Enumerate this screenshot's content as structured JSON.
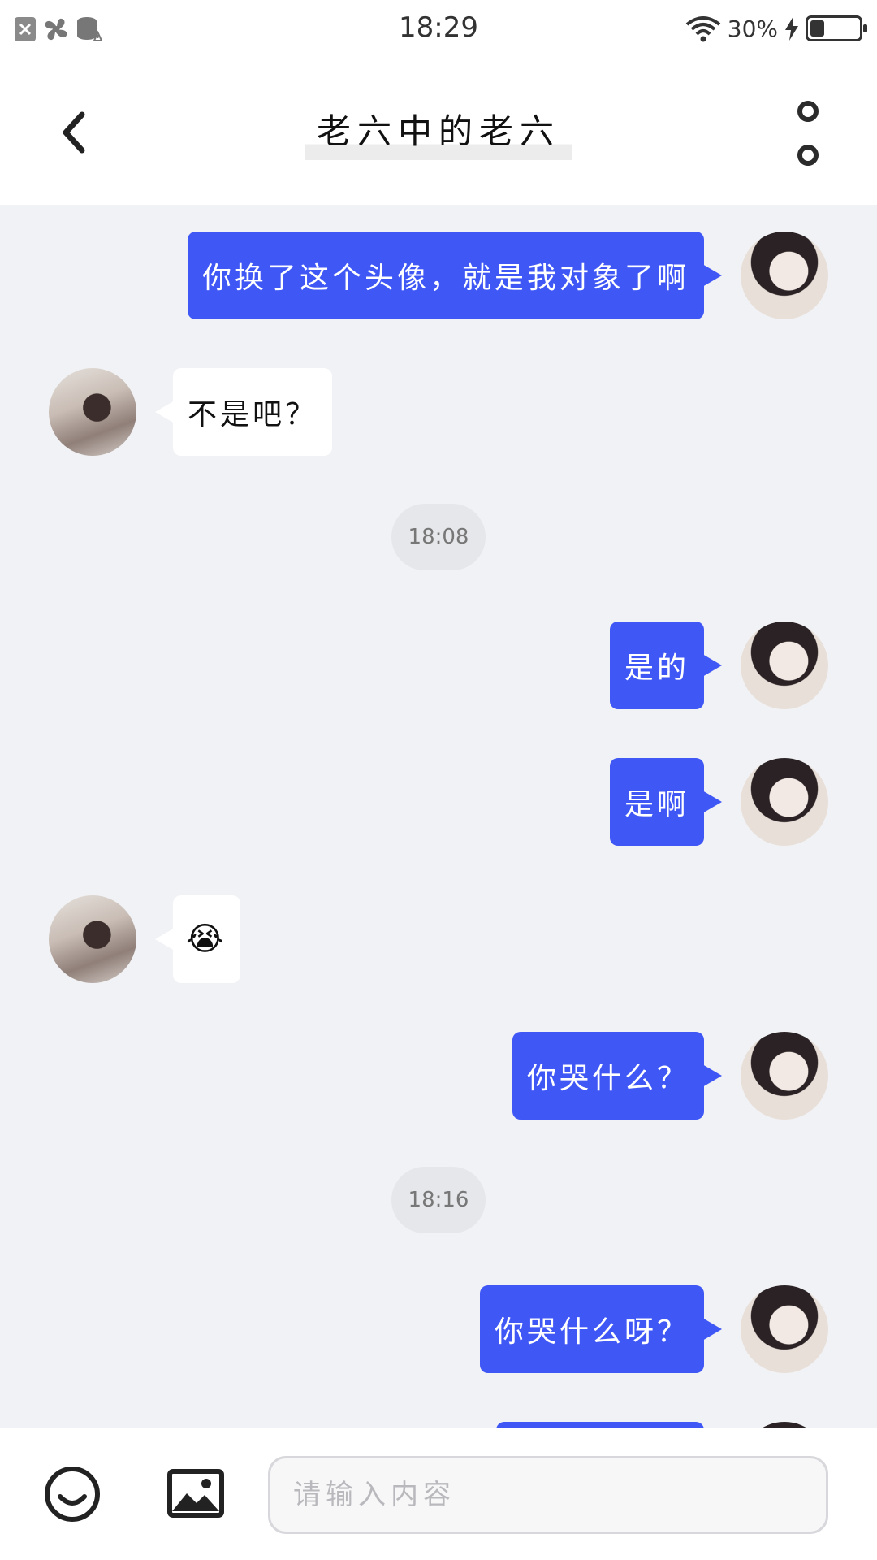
{
  "status_bar": {
    "time": "18:29",
    "battery_percent_label": "30%",
    "battery_level": 0.3,
    "icons": [
      "notification-x-icon",
      "fan-app-icon",
      "storage-warning-icon",
      "wifi-icon",
      "charging-bolt-icon",
      "battery-icon"
    ]
  },
  "header": {
    "title": "老六中的老六",
    "back_icon": "chevron-left-icon",
    "more_icon": "more-vertical-icon"
  },
  "messages": [
    {
      "from": "me",
      "text": "你换了这个头像，就是我对象了啊"
    },
    {
      "from": "other",
      "text": "不是吧？"
    },
    {
      "type": "time",
      "text": "18:08"
    },
    {
      "from": "me",
      "text": "是的"
    },
    {
      "from": "me",
      "text": "是啊"
    },
    {
      "from": "other",
      "text": "😭",
      "kind": "emoji"
    },
    {
      "from": "me",
      "text": "你哭什么？"
    },
    {
      "type": "time",
      "text": "18:16"
    },
    {
      "from": "me",
      "text": "你哭什么呀？"
    }
  ],
  "input_bar": {
    "placeholder": "请输入内容",
    "emoji_icon": "smiley-icon",
    "image_icon": "image-icon"
  },
  "colors": {
    "my_bubble": "#3f57f5",
    "chat_background": "#f1f2f5"
  }
}
